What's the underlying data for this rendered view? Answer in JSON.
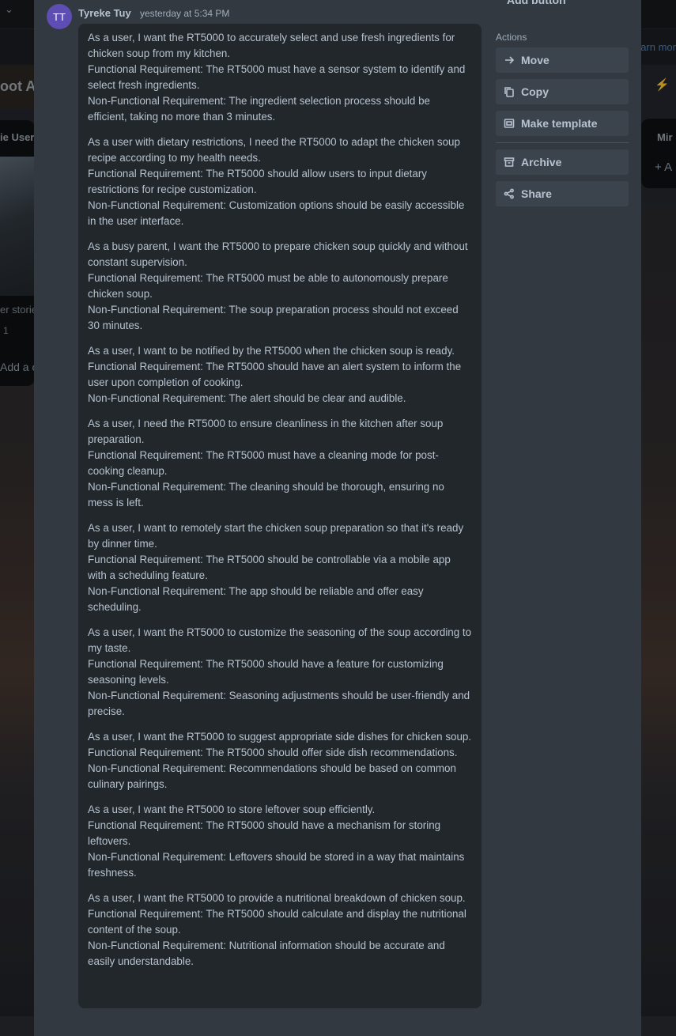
{
  "background": {
    "board_title_fragment": "oot A",
    "learn_more_fragment": "arn mor",
    "left_list_title_fragment": "ie User",
    "left_card_text_fragment": "er storie",
    "left_card_count": "1",
    "add_card_fragment": "Add a c",
    "right_list_title_fragment": "Mir",
    "right_list_add_fragment": "+ A"
  },
  "comment": {
    "avatar_initials": "TT",
    "author": "Tyreke Tuy",
    "timestamp": "yesterday at 5:34 PM",
    "paragraphs": [
      "As a user, I want the RT5000 to accurately select and use fresh ingredients for chicken soup from my kitchen.\nFunctional Requirement: The RT5000 must have a sensor system to identify and select fresh ingredients.\nNon-Functional Requirement: The ingredient selection process should be efficient, taking no more than 3 minutes.",
      "As a user with dietary restrictions, I need the RT5000 to adapt the chicken soup recipe according to my health needs.\nFunctional Requirement: The RT5000 should allow users to input dietary restrictions for recipe customization.\nNon-Functional Requirement: Customization options should be easily accessible in the user interface.",
      "As a busy parent, I want the RT5000 to prepare chicken soup quickly and without constant supervision.\nFunctional Requirement: The RT5000 must be able to autonomously prepare chicken soup.\nNon-Functional Requirement: The soup preparation process should not exceed 30 minutes.",
      "As a user, I want to be notified by the RT5000 when the chicken soup is ready.\nFunctional Requirement: The RT5000 should have an alert system to inform the user upon completion of cooking.\nNon-Functional Requirement: The alert should be clear and audible.",
      "As a user, I need the RT5000 to ensure cleanliness in the kitchen after soup preparation.\nFunctional Requirement: The RT5000 must have a cleaning mode for post-cooking cleanup.\nNon-Functional Requirement: The cleaning should be thorough, ensuring no mess is left.",
      "As a user, I want to remotely start the chicken soup preparation so that it's ready by dinner time.\nFunctional Requirement: The RT5000 should be controllable via a mobile app with a scheduling feature.\nNon-Functional Requirement: The app should be reliable and offer easy scheduling.",
      "As a user, I want the RT5000 to customize the seasoning of the soup according to my taste.\nFunctional Requirement: The RT5000 should have a feature for customizing seasoning levels.\nNon-Functional Requirement: Seasoning adjustments should be user-friendly and precise.",
      "As a user, I want the RT5000 to suggest appropriate side dishes for chicken soup.\nFunctional Requirement: The RT5000 should offer side dish recommendations.\nNon-Functional Requirement: Recommendations should be based on common culinary pairings.",
      "As a user, I want the RT5000 to store leftover soup efficiently.\nFunctional Requirement: The RT5000 should have a mechanism for storing leftovers.\nNon-Functional Requirement: Leftovers should be stored in a way that maintains freshness.",
      "As a user, I want the RT5000 to provide a nutritional breakdown of chicken soup.\nFunctional Requirement: The RT5000 should calculate and display the nutritional content of the soup.\nNon-Functional Requirement: Nutritional information should be accurate and easily understandable."
    ]
  },
  "sidebar": {
    "add_button_label": "Add button",
    "actions_title": "Actions",
    "actions": [
      {
        "label": "Move",
        "icon": "arrow-right-icon"
      },
      {
        "label": "Copy",
        "icon": "copy-icon"
      },
      {
        "label": "Make template",
        "icon": "template-icon"
      },
      {
        "label": "Archive",
        "icon": "archive-icon"
      },
      {
        "label": "Share",
        "icon": "share-icon"
      }
    ]
  },
  "colors": {
    "modal_bg": "#323940",
    "comment_bg": "#22272b",
    "button_bg": "#3b444c",
    "avatar_bg": "#5e4db2",
    "text": "#b6c2cf"
  }
}
